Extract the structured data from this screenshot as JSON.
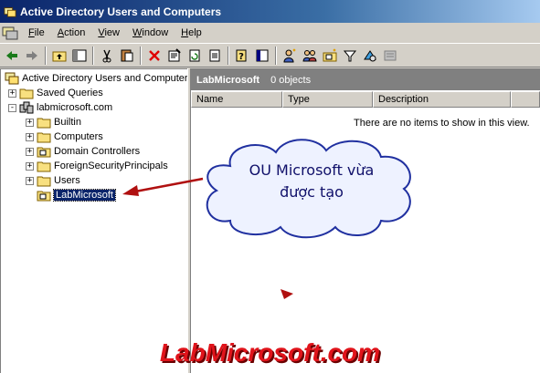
{
  "window": {
    "title": "Active Directory Users and Computers"
  },
  "menu": {
    "items": [
      "File",
      "Action",
      "View",
      "Window",
      "Help"
    ]
  },
  "toolbar": {
    "buttons": [
      "back-icon",
      "forward-icon",
      "up-folder-icon",
      "show-hide-tree-icon",
      "cut-icon",
      "paste-icon",
      "delete-icon",
      "properties-icon",
      "refresh-icon",
      "export-icon",
      "help-icon",
      "console-icon",
      "add-user-icon",
      "add-group-icon",
      "add-ou-icon",
      "filter-icon",
      "find-icon",
      "add-to-group-icon"
    ]
  },
  "tree": {
    "root": "Active Directory Users and Computer",
    "saved_queries": "Saved Queries",
    "domain": "labmicrosoft.com",
    "children": [
      "Builtin",
      "Computers",
      "Domain Controllers",
      "ForeignSecurityPrincipals",
      "Users",
      "LabMicrosoft"
    ]
  },
  "right": {
    "title": "LabMicrosoft",
    "count": "0 objects",
    "columns": [
      "Name",
      "Type",
      "Description"
    ],
    "empty_message": "There are no items to show in this view."
  },
  "annotation": {
    "line1": "OU Microsoft vừa",
    "line2": "được tạo"
  },
  "watermark": "LabMicrosoft.com",
  "colors": {
    "selection": "#0a246a",
    "watermark": "#e0141b",
    "arrow": "#b01010"
  }
}
